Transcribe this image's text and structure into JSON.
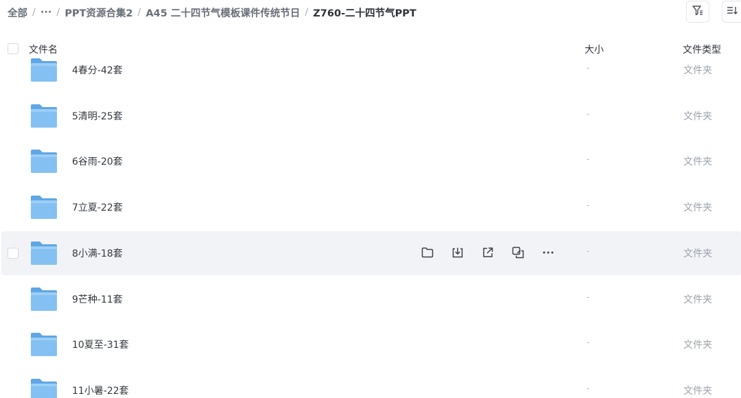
{
  "breadcrumb": {
    "items": [
      "全部",
      "···",
      "PPT资源合集2",
      "A45 二十四节气模板课件传统节日",
      "Z760-二十四节气PPT"
    ],
    "separator": "/"
  },
  "toolbar": {
    "icons": [
      "filter-icon",
      "sort-list-icon"
    ]
  },
  "table": {
    "headers": {
      "name": "文件名",
      "size": "大小",
      "type": "文件类型"
    },
    "rows": [
      {
        "name": "4春分-42套",
        "size": "-",
        "type": "文件夹"
      },
      {
        "name": "5清明-25套",
        "size": "-",
        "type": "文件夹"
      },
      {
        "name": "6谷雨-20套",
        "size": "-",
        "type": "文件夹"
      },
      {
        "name": "7立夏-22套",
        "size": "-",
        "type": "文件夹"
      },
      {
        "name": "8小满-18套",
        "size": "-",
        "type": "文件夹",
        "hovered": true
      },
      {
        "name": "9芒种-11套",
        "size": "-",
        "type": "文件夹"
      },
      {
        "name": "10夏至-31套",
        "size": "-",
        "type": "文件夹"
      },
      {
        "name": "11小暑-22套",
        "size": "-",
        "type": "文件夹"
      }
    ],
    "hover_actions": [
      "open-folder-icon",
      "download-icon",
      "share-icon",
      "copy-link-icon",
      "more-icon"
    ]
  },
  "colors": {
    "folder": "#7ab9ef",
    "hover_row": "#f2f3f6",
    "muted_text": "#9ca1aa"
  }
}
